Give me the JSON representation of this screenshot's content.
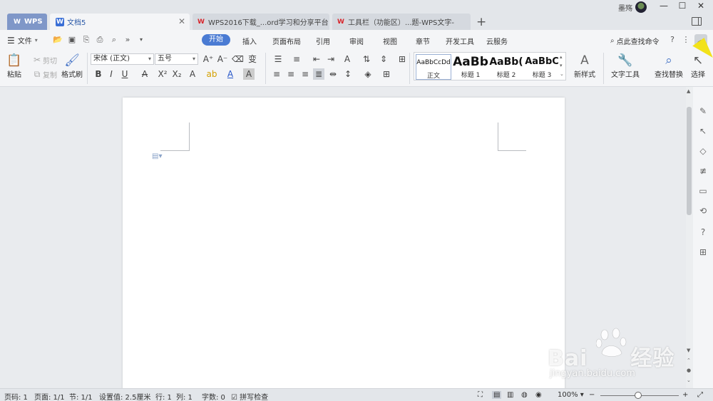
{
  "titlebar": {
    "tabs": [
      {
        "label": "WPS"
      },
      {
        "label": "文档5"
      },
      {
        "label": "WPS2016下载_...ord学习和分享平台"
      },
      {
        "label": "工具栏（功能区）...题-WPS文字-"
      }
    ],
    "user_name": "墨殇"
  },
  "menu": {
    "file_label": "文件",
    "items": [
      "开始",
      "插入",
      "页面布局",
      "引用",
      "审阅",
      "视图",
      "章节",
      "开发工具",
      "云服务"
    ],
    "search_command": "点此查找命令"
  },
  "ribbon": {
    "paste": "粘贴",
    "cut": "剪切",
    "copy": "复制",
    "format_painter": "格式刷",
    "font_name": "宋体 (正文)",
    "font_size": "五号",
    "styles": [
      {
        "preview": "AaBbCcDd",
        "name": "正文"
      },
      {
        "preview": "AaBb",
        "name": "标题 1"
      },
      {
        "preview": "AaBb(",
        "name": "标题 2"
      },
      {
        "preview": "AaBbC",
        "name": "标题 3"
      }
    ],
    "new_style": "新样式",
    "text_tools": "文字工具",
    "find_replace": "查找替换",
    "select": "选择"
  },
  "statusbar": {
    "page_num": "页码: 1",
    "pages": "页面: 1/1",
    "section": "节: 1/1",
    "setting": "设置值: 2.5厘米",
    "row": "行: 1",
    "col": "列: 1",
    "word_count": "字数: 0",
    "spell_check": "拼写检查",
    "zoom": "100%"
  },
  "watermark": {
    "brand": "Bai",
    "brand_cn": "经验",
    "url": "jingyan.baidu.com"
  },
  "colors": {
    "accent": "#4a7bd3",
    "tab_wps": "#7f97c8",
    "cursor": "#f2e21a"
  }
}
